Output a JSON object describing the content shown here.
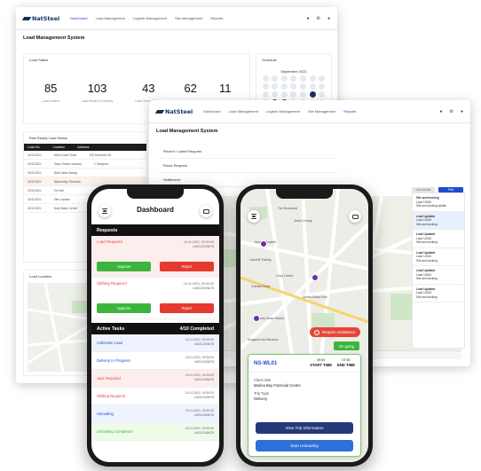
{
  "brand": "NatSteel",
  "nav": [
    "Dashboard",
    "Load Management",
    "Logistic Management",
    "Site Management",
    "Reports"
  ],
  "page_title": "Load Management System",
  "stats": {
    "heading": "Load Status",
    "items": [
      {
        "value": "85",
        "label": "Load Created"
      },
      {
        "value": "103",
        "label": "Load Ready For Delivery"
      },
      {
        "value": "43",
        "label": "Load Out for Delivery"
      },
      {
        "value": "62",
        "label": ""
      },
      {
        "value": "11",
        "label": ""
      }
    ]
  },
  "calendar": {
    "heading": "Schedule",
    "month": "September 2021"
  },
  "table": {
    "heading": "Risk Ready Load Status",
    "columns": [
      "Load No.",
      "Location",
      "Address"
    ],
    "rows": [
      [
        "15/11/2021",
        "West Coast Tower",
        "130 Somerset Rd"
      ],
      [
        "15/11/2021",
        "Seiyo Tampin Industry",
        "2 Tampines"
      ],
      [
        "15/11/2021",
        "Bukit Jalan Kalang",
        ""
      ],
      [
        "15/11/2021",
        "Marina Bay Financial",
        ""
      ],
      [
        "15/11/2021",
        "Tpi Hall",
        ""
      ],
      [
        "15/11/2021",
        "Site Location",
        ""
      ],
      [
        "15/11/2021",
        "Bukit Batok Centre",
        ""
      ]
    ]
  },
  "map_heading": "Load Location",
  "front_list": [
    "Recent / Latest Request",
    "Route Request",
    "Settlement"
  ],
  "front_buttons": {
    "secondary": "View Details",
    "primary": "Print"
  },
  "side_list": [
    {
      "title": "Site and booking",
      "lines": [
        "Load 12345",
        "Site and booking details"
      ]
    },
    {
      "title": "Load Updated",
      "lines": [
        "Load 12345",
        "Site and booking"
      ]
    },
    {
      "title": "Load Updated",
      "lines": [
        "Load 12345",
        "Site and booking"
      ]
    },
    {
      "title": "Load Updated",
      "lines": [
        "Load 12345",
        "Site and booking"
      ]
    },
    {
      "title": "Load Updated",
      "lines": [
        "Load 12345",
        "Site and booking"
      ]
    },
    {
      "title": "Load Updated",
      "lines": [
        "Load 12345",
        "Site and booking"
      ]
    }
  ],
  "phone1": {
    "title": "Dashboard",
    "requests_heading": "Requests",
    "requests": [
      {
        "title": "Load Required",
        "date": "19-11-2021, 09:30:00",
        "id": "LMD12345678",
        "approve": "Approve",
        "reject": "Reject"
      },
      {
        "title": "Shifting Required",
        "date": "19-11-2021, 09:30:00",
        "id": "LMD12345678",
        "approve": "Approve",
        "reject": "Reject"
      }
    ],
    "tasks_heading": "Active Tasks",
    "tasks_count": "4/10 Completed",
    "tasks": [
      {
        "title": "Collection Load",
        "color": "#1f4bd1",
        "bg": "#eef3ff",
        "date": "19-11-2021, 09:30:00",
        "id": "LMD12345678"
      },
      {
        "title": "Delivery In Progress",
        "color": "#1f4bd1",
        "bg": "#ffffff",
        "date": "19-11-2021, 09:30:00",
        "id": "LMD12345678"
      },
      {
        "title": "Jack Required",
        "color": "#e5443a",
        "bg": "#fdeeee",
        "date": "19-11-2021, 09:30:00",
        "id": "LMD12345678"
      },
      {
        "title": "Shifting Required",
        "color": "#e5443a",
        "bg": "#ffffff",
        "date": "19-11-2021, 09:30:00",
        "id": "LMD12345678"
      },
      {
        "title": "Unloading",
        "color": "#1f4bd1",
        "bg": "#eef3ff",
        "date": "19-11-2021, 09:30:00",
        "id": "LMD12345678"
      },
      {
        "title": "Unloading Completed",
        "color": "#3db53d",
        "bg": "#eefbe9",
        "date": "19-11-2021, 09:30:00",
        "id": "LMD12345678"
      }
    ]
  },
  "phone2": {
    "alert": "Require Assistance",
    "status": "On going",
    "trip_id": "NS-WL01",
    "start_time": "09:00",
    "start_label": "START TIME",
    "end_time": "07:30",
    "end_label": "END TIME",
    "client_site_label": "Client Site",
    "client_site": "Marina Bay Financial Centre",
    "trip_type_label": "Trip Type",
    "trip_type": "Delivery",
    "btn_view": "View Trip Information",
    "btn_start": "Start Unloading",
    "map_labels": [
      "The Boulevard",
      "Jewel Changi",
      "Mount Elizabeth",
      "Cairnhill Trading",
      "Orchard Road",
      "Dhoby Ghaut Station",
      "Dhoby Ghaut Park",
      "Lloyd Centre",
      "Singapore Art Museum"
    ]
  }
}
